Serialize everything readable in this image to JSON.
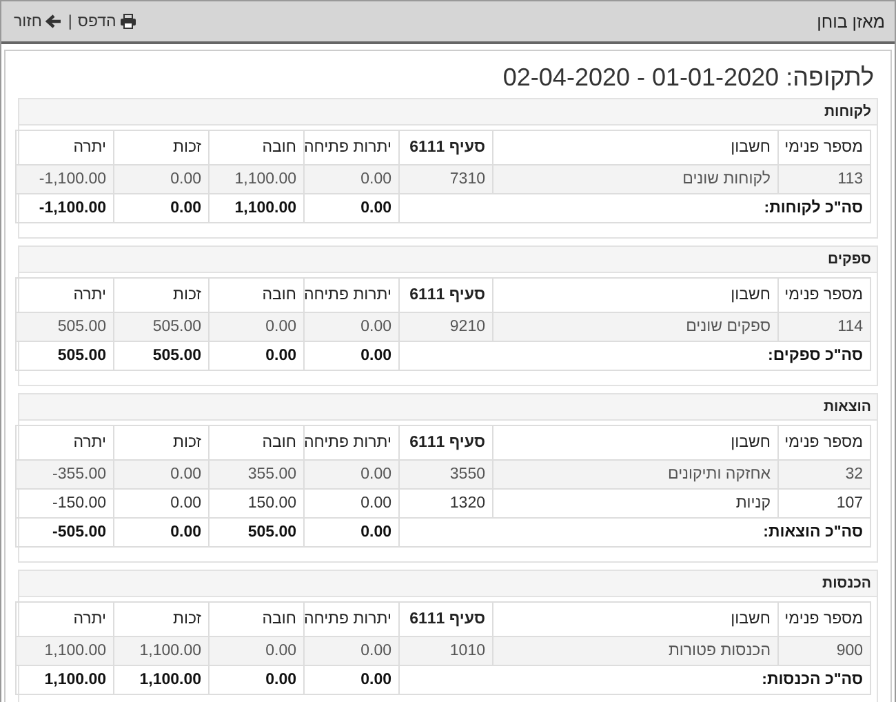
{
  "window": {
    "title": "מאזן בוחן"
  },
  "toolbar": {
    "actions": [
      {
        "kind": "print",
        "label": "הדפס"
      },
      {
        "kind": "back",
        "label": "חזור"
      }
    ],
    "separator": "|"
  },
  "period_title": "לתקופה: 01-01-2020 - 02-04-2020",
  "sections": [
    {
      "title": "לקוחות",
      "columns": [
        {
          "label": "מספר פנימי",
          "bold": false
        },
        {
          "label": "חשבון",
          "bold": false
        },
        {
          "label": "סעיף 6111",
          "bold": true
        },
        {
          "label": "יתרות פתיחה",
          "bold": false
        },
        {
          "label": "חובה",
          "bold": false
        },
        {
          "label": "זכות",
          "bold": false
        },
        {
          "label": "יתרה",
          "bold": false
        }
      ],
      "rows": [
        [
          "113",
          "לקוחות שונים",
          "7310",
          "0.00",
          "1,100.00",
          "0.00",
          "-1,100.00"
        ]
      ],
      "total": {
        "label": "סה\"כ לקוחות:",
        "values": [
          "0.00",
          "1,100.00",
          "0.00",
          "-1,100.00"
        ]
      }
    },
    {
      "title": "ספקים",
      "columns": [
        {
          "label": "מספר פנימי",
          "bold": false
        },
        {
          "label": "חשבון",
          "bold": false
        },
        {
          "label": "סעיף 6111",
          "bold": true
        },
        {
          "label": "יתרות פתיחה",
          "bold": false
        },
        {
          "label": "חובה",
          "bold": false
        },
        {
          "label": "זכות",
          "bold": false
        },
        {
          "label": "יתרה",
          "bold": false
        }
      ],
      "rows": [
        [
          "114",
          "ספקים שונים",
          "9210",
          "0.00",
          "0.00",
          "505.00",
          "505.00"
        ]
      ],
      "total": {
        "label": "סה\"כ ספקים:",
        "values": [
          "0.00",
          "0.00",
          "505.00",
          "505.00"
        ]
      }
    },
    {
      "title": "הוצאות",
      "columns": [
        {
          "label": "מספר פנימי",
          "bold": false
        },
        {
          "label": "חשבון",
          "bold": false
        },
        {
          "label": "סעיף 6111",
          "bold": true
        },
        {
          "label": "יתרות פתיחה",
          "bold": false
        },
        {
          "label": "חובה",
          "bold": false
        },
        {
          "label": "זכות",
          "bold": false
        },
        {
          "label": "יתרה",
          "bold": false
        }
      ],
      "rows": [
        [
          "32",
          "אחזקה ותיקונים",
          "3550",
          "0.00",
          "355.00",
          "0.00",
          "-355.00"
        ],
        [
          "107",
          "קניות",
          "1320",
          "0.00",
          "150.00",
          "0.00",
          "-150.00"
        ]
      ],
      "total": {
        "label": "סה\"כ הוצאות:",
        "values": [
          "0.00",
          "505.00",
          "0.00",
          "-505.00"
        ]
      }
    },
    {
      "title": "הכנסות",
      "columns": [
        {
          "label": "מספר פנימי",
          "bold": false
        },
        {
          "label": "חשבון",
          "bold": false
        },
        {
          "label": "סעיף 6111",
          "bold": true
        },
        {
          "label": "יתרות פתיחה",
          "bold": false
        },
        {
          "label": "חובה",
          "bold": false
        },
        {
          "label": "זכות",
          "bold": false
        },
        {
          "label": "יתרה",
          "bold": false
        }
      ],
      "rows": [
        [
          "900",
          "הכנסות פטורות",
          "1010",
          "0.00",
          "0.00",
          "1,100.00",
          "1,100.00"
        ]
      ],
      "total": {
        "label": "סה\"כ הכנסות:",
        "values": [
          "0.00",
          "0.00",
          "1,100.00",
          "1,100.00"
        ]
      }
    }
  ]
}
